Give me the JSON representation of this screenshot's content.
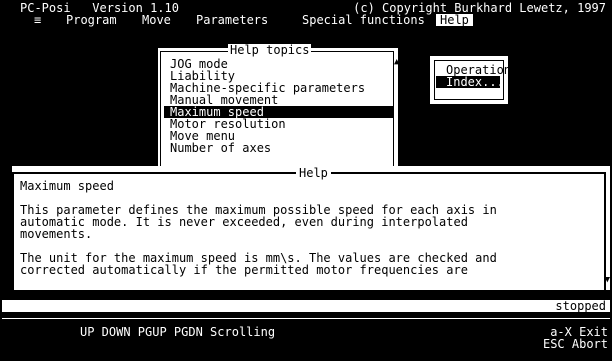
{
  "titlebar": {
    "app_name": "PC-Posi",
    "version": "Version 1.10",
    "copyright": "(c) Copyright Burkhard Lewetz, 1997"
  },
  "menubar": {
    "system": "≡",
    "items": [
      "Program",
      "Move",
      "Parameters",
      "Special functions",
      "Help"
    ]
  },
  "help_menu": {
    "items": [
      "Operation",
      "Index..."
    ],
    "selected": "Index..."
  },
  "topics": {
    "title": "Help topics",
    "items": [
      "JOG mode",
      "Liability",
      "Machine-specific parameters",
      "Manual movement",
      "Maximum speed",
      "Motor resolution",
      "Move menu",
      "Number of axes"
    ],
    "selected_index": 4
  },
  "help": {
    "title": "Help",
    "lines": [
      "Maximum speed",
      "",
      "This parameter defines the maximum possible speed for each axis in",
      "automatic mode. It is never exceeded, even during interpolated",
      "movements.",
      "",
      "The unit for the maximum speed is mm\\s. The values are checked and",
      "corrected automatically if the permitted motor frequencies are"
    ]
  },
  "status": {
    "state": "stopped"
  },
  "keys": {
    "scrolling": "UP DOWN PGUP PGDN Scrolling",
    "exit": "a-X Exit",
    "abort": "ESC Abort"
  },
  "icons": {
    "scroll_up": "triangle-up",
    "scroll_down": "triangle-down"
  },
  "colors": {
    "background": "#000000",
    "foreground": "#ffffff"
  }
}
